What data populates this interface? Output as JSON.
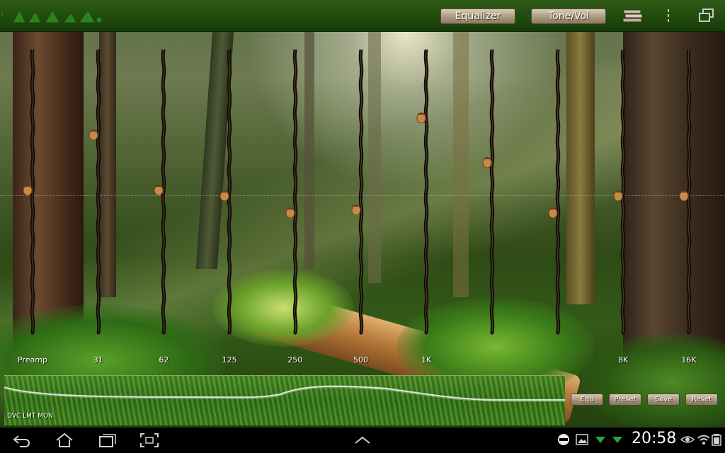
{
  "titlebar": {
    "equalizer_label": "Equalizer",
    "tone_vol_label": "Tone/Vol"
  },
  "sliders": [
    {
      "label": "Preamp",
      "level": 0.52
    },
    {
      "label": "31",
      "level": 0.72
    },
    {
      "label": "62",
      "level": 0.52
    },
    {
      "label": "125",
      "level": 0.5
    },
    {
      "label": "250",
      "level": 0.44
    },
    {
      "label": "500",
      "level": 0.45
    },
    {
      "label": "1K",
      "level": 0.78
    },
    {
      "label": "",
      "level": 0.62
    },
    {
      "label": "",
      "level": 0.44
    },
    {
      "label": "8K",
      "level": 0.5
    },
    {
      "label": "16K",
      "level": 0.5
    }
  ],
  "bottom_panel": {
    "dvc_label": "DVC LMT MON",
    "equ_label": "Equ",
    "preset_label": "Preset",
    "save_label": "Save",
    "reset_label": "Reset"
  },
  "statusbar": {
    "time": "20:58"
  },
  "colors": {
    "titlebar": "#1f4a0c",
    "accent_green": "#2b8a1a",
    "wood": "#a99a80"
  }
}
